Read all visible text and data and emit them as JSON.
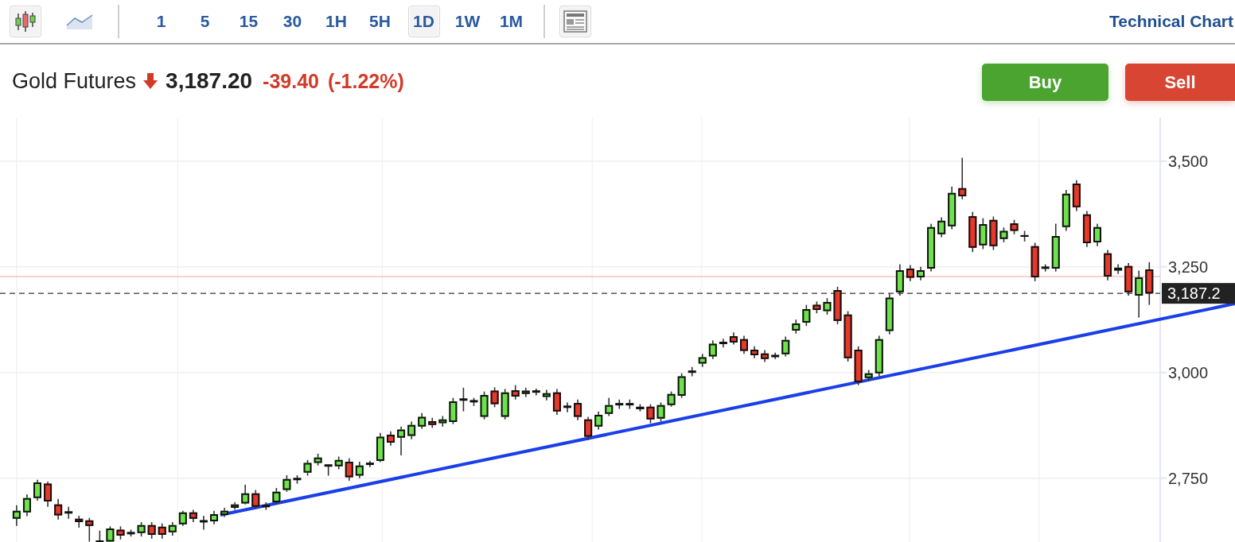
{
  "toolbar": {
    "chart_types": [
      {
        "kind": "candles",
        "selected": true
      },
      {
        "kind": "line",
        "selected": false
      }
    ],
    "intervals": [
      {
        "label": "1",
        "selected": false
      },
      {
        "label": "5",
        "selected": false
      },
      {
        "label": "15",
        "selected": false
      },
      {
        "label": "30",
        "selected": false
      },
      {
        "label": "1H",
        "selected": false
      },
      {
        "label": "5H",
        "selected": false
      },
      {
        "label": "1D",
        "selected": true
      },
      {
        "label": "1W",
        "selected": false
      },
      {
        "label": "1M",
        "selected": false
      }
    ],
    "link": "Technical Chart"
  },
  "quote": {
    "name": "Gold Futures",
    "kind": "down",
    "price": "3,187.20",
    "change": "-39.40",
    "change_percent": "(-1.22%)"
  },
  "actions": [
    {
      "kind": "buy",
      "label": "Buy"
    },
    {
      "kind": "sell",
      "label": "Sell"
    }
  ],
  "chart": {
    "chart_data": {
      "type": "candlestick",
      "grid": true,
      "ylim": [
        2599,
        3603
      ],
      "yticks": [
        {
          "value": 2750,
          "label": "2,750"
        },
        {
          "value": 3000,
          "label": "3,000"
        },
        {
          "value": 3250,
          "label": "3,250"
        },
        {
          "value": 3500,
          "label": "3,500"
        }
      ],
      "ohlc": [
        [
          2654,
          2686,
          2637,
          2673
        ],
        [
          2669,
          2712,
          2660,
          2703
        ],
        [
          2703,
          2746,
          2697,
          2740
        ],
        [
          2737,
          2742,
          2682,
          2695
        ],
        [
          2688,
          2701,
          2652,
          2662
        ],
        [
          2669,
          2682,
          2654,
          2669
        ],
        [
          2654,
          2661,
          2633,
          2646
        ],
        [
          2650,
          2656,
          2600,
          2637
        ],
        [
          2600,
          2626,
          2600,
          2600
        ],
        [
          2600,
          2636,
          2600,
          2631
        ],
        [
          2628,
          2636,
          2605,
          2614
        ],
        [
          2620,
          2628,
          2612,
          2620
        ],
        [
          2620,
          2646,
          2612,
          2639
        ],
        [
          2639,
          2646,
          2607,
          2616
        ],
        [
          2635,
          2643,
          2607,
          2616
        ],
        [
          2622,
          2646,
          2614,
          2639
        ],
        [
          2641,
          2673,
          2637,
          2669
        ],
        [
          2669,
          2675,
          2646,
          2654
        ],
        [
          2648,
          2661,
          2628,
          2648
        ],
        [
          2648,
          2673,
          2641,
          2665
        ],
        [
          2663,
          2680,
          2658,
          2673
        ],
        [
          2680,
          2693,
          2675,
          2688
        ],
        [
          2690,
          2735,
          2688,
          2714
        ],
        [
          2714,
          2722,
          2680,
          2682
        ],
        [
          2684,
          2693,
          2675,
          2684
        ],
        [
          2693,
          2727,
          2688,
          2718
        ],
        [
          2722,
          2757,
          2718,
          2748
        ],
        [
          2748,
          2757,
          2737,
          2748
        ],
        [
          2763,
          2793,
          2756,
          2786
        ],
        [
          2786,
          2808,
          2780,
          2799
        ],
        [
          2780,
          2782,
          2756,
          2780
        ],
        [
          2778,
          2801,
          2771,
          2793
        ],
        [
          2789,
          2797,
          2744,
          2752
        ],
        [
          2756,
          2789,
          2750,
          2780
        ],
        [
          2784,
          2791,
          2776,
          2784
        ],
        [
          2791,
          2857,
          2788,
          2848
        ],
        [
          2853,
          2861,
          2827,
          2834
        ],
        [
          2846,
          2872,
          2804,
          2865
        ],
        [
          2850,
          2884,
          2842,
          2876
        ],
        [
          2872,
          2904,
          2867,
          2895
        ],
        [
          2885,
          2893,
          2869,
          2876
        ],
        [
          2880,
          2897,
          2872,
          2889
        ],
        [
          2883,
          2940,
          2878,
          2932
        ],
        [
          2936,
          2964,
          2908,
          2936
        ],
        [
          2932,
          2940,
          2921,
          2932
        ],
        [
          2895,
          2955,
          2889,
          2947
        ],
        [
          2957,
          2965,
          2918,
          2925
        ],
        [
          2895,
          2961,
          2889,
          2953
        ],
        [
          2958,
          2970,
          2936,
          2943
        ],
        [
          2949,
          2964,
          2942,
          2957
        ],
        [
          2955,
          2962,
          2946,
          2955
        ],
        [
          2942,
          2959,
          2934,
          2951
        ],
        [
          2953,
          2961,
          2900,
          2908
        ],
        [
          2919,
          2929,
          2906,
          2919
        ],
        [
          2928,
          2936,
          2887,
          2895
        ],
        [
          2889,
          2895,
          2840,
          2848
        ],
        [
          2872,
          2908,
          2865,
          2900
        ],
        [
          2902,
          2940,
          2897,
          2923
        ],
        [
          2925,
          2936,
          2914,
          2925
        ],
        [
          2925,
          2936,
          2914,
          2925
        ],
        [
          2919,
          2925,
          2908,
          2913
        ],
        [
          2919,
          2925,
          2880,
          2889
        ],
        [
          2891,
          2929,
          2884,
          2923
        ],
        [
          2923,
          2955,
          2919,
          2949
        ],
        [
          2945,
          2998,
          2940,
          2991
        ],
        [
          3002,
          3013,
          2991,
          3002
        ],
        [
          3021,
          3044,
          3013,
          3036
        ],
        [
          3038,
          3076,
          3032,
          3068
        ],
        [
          3070,
          3080,
          3059,
          3070
        ],
        [
          3086,
          3095,
          3066,
          3071
        ],
        [
          3079,
          3087,
          3044,
          3051
        ],
        [
          3054,
          3062,
          3034,
          3041
        ],
        [
          3045,
          3053,
          3025,
          3032
        ],
        [
          3039,
          3047,
          3032,
          3039
        ],
        [
          3043,
          3085,
          3038,
          3077
        ],
        [
          3099,
          3125,
          3092,
          3116
        ],
        [
          3118,
          3160,
          3110,
          3150
        ],
        [
          3160,
          3168,
          3140,
          3148
        ],
        [
          3145,
          3176,
          3137,
          3167
        ],
        [
          3195,
          3203,
          3114,
          3122
        ],
        [
          3137,
          3145,
          3026,
          3034
        ],
        [
          3054,
          3062,
          2970,
          2977
        ],
        [
          2987,
          3006,
          2979,
          2998
        ],
        [
          2998,
          3087,
          2991,
          3079
        ],
        [
          3098,
          3186,
          3090,
          3177
        ],
        [
          3190,
          3256,
          3182,
          3242
        ],
        [
          3246,
          3254,
          3216,
          3224
        ],
        [
          3225,
          3250,
          3218,
          3242
        ],
        [
          3246,
          3352,
          3239,
          3344
        ],
        [
          3327,
          3367,
          3320,
          3359
        ],
        [
          3346,
          3440,
          3339,
          3425
        ],
        [
          3436,
          3508,
          3410,
          3417
        ],
        [
          3370,
          3380,
          3285,
          3295
        ],
        [
          3301,
          3365,
          3292,
          3351
        ],
        [
          3361,
          3369,
          3290,
          3299
        ],
        [
          3316,
          3343,
          3308,
          3335
        ],
        [
          3353,
          3361,
          3327,
          3335
        ],
        [
          3325,
          3335,
          3310,
          3321
        ],
        [
          3299,
          3307,
          3216,
          3225
        ],
        [
          3248,
          3256,
          3239,
          3248
        ],
        [
          3246,
          3352,
          3239,
          3323
        ],
        [
          3344,
          3432,
          3335,
          3423
        ],
        [
          3447,
          3455,
          3382,
          3391
        ],
        [
          3374,
          3382,
          3297,
          3306
        ],
        [
          3308,
          3352,
          3299,
          3344
        ],
        [
          3282,
          3290,
          3218,
          3227
        ],
        [
          3241,
          3256,
          3233,
          3248
        ],
        [
          3252,
          3259,
          3182,
          3190
        ],
        [
          3182,
          3241,
          3130,
          3225
        ],
        [
          3244,
          3261,
          3160,
          3187
        ]
      ],
      "ref_lines": [
        {
          "axis": "y",
          "value": 3227,
          "color": "#f4a3a3"
        },
        {
          "axis": "y",
          "value": 3187.2,
          "color": "#333333",
          "label": "3,187.2"
        }
      ]
    }
  }
}
